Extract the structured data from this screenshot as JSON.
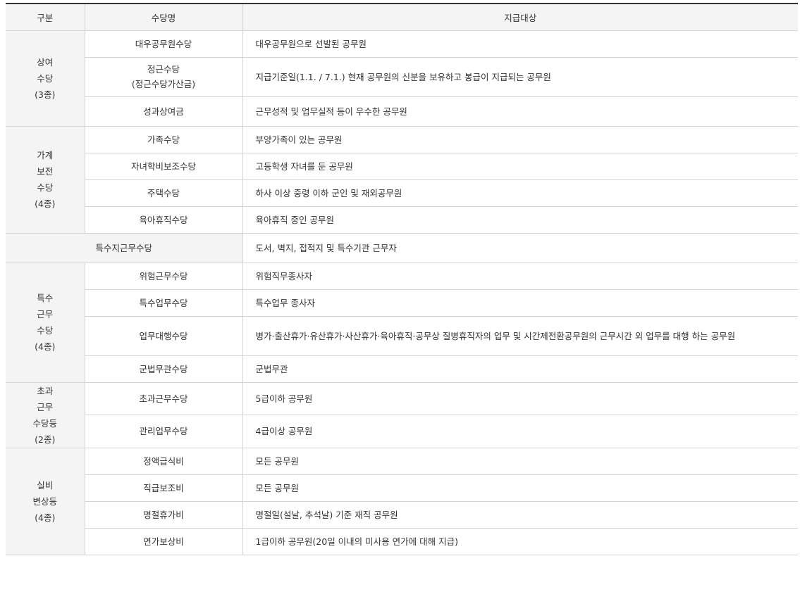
{
  "header": {
    "col1": "구분",
    "col2": "수당명",
    "col3": "지급대상"
  },
  "groups": [
    {
      "category": [
        "상여",
        "수당",
        "(3종)"
      ],
      "rows": [
        {
          "name": [
            "대우공무원수당"
          ],
          "target": "대우공무원으로 선발된 공무원"
        },
        {
          "name": [
            "정근수당",
            "(정근수당가산금)"
          ],
          "target": "지급기준일(1.1. / 7.1.) 현재 공무원의 신분을 보유하고 봉급이 지급되는 공무원"
        },
        {
          "name": [
            "성과상여금"
          ],
          "target": "근무성적 및 업무실적 등이 우수한 공무원"
        }
      ]
    },
    {
      "category": [
        "가계",
        "보전",
        "수당",
        "(4종)"
      ],
      "rows": [
        {
          "name": [
            "가족수당"
          ],
          "target": "부양가족이 있는 공무원"
        },
        {
          "name": [
            "자녀학비보조수당"
          ],
          "target": "고등학생 자녀를 둔 공무원"
        },
        {
          "name": [
            "주택수당"
          ],
          "target": "하사 이상 중령 이하 군인 및 재외공무원"
        },
        {
          "name": [
            "육아휴직수당"
          ],
          "target": "육아휴직 중인 공무원"
        }
      ]
    },
    {
      "wide_name": "특수지근무수당",
      "wide_target": "도서, 벽지, 접적지 및 특수기관 근무자"
    },
    {
      "category": [
        "특수",
        "근무",
        "수당",
        "(4종)"
      ],
      "rows": [
        {
          "name": [
            "위험근무수당"
          ],
          "target": "위험직무종사자"
        },
        {
          "name": [
            "특수업무수당"
          ],
          "target": "특수업무 종사자"
        },
        {
          "name": [
            "업무대행수당"
          ],
          "target": "병가·출산휴가·유산휴가·사산휴가·육아휴직·공무상 질병휴직자의 업무 및 시간제전환공무원의 근무시간 외 업무를 대행 하는 공무원"
        },
        {
          "name": [
            "군법무관수당"
          ],
          "target": "군법무관"
        }
      ]
    },
    {
      "category": [
        "초과",
        "근무",
        "수당등",
        "(2종)"
      ],
      "rows": [
        {
          "name": [
            "초과근무수당"
          ],
          "target": "5급이하 공무원"
        },
        {
          "name": [
            "관리업무수당"
          ],
          "target": "4급이상 공무원"
        }
      ]
    },
    {
      "category": [
        "실비",
        "변상등",
        "(4종)"
      ],
      "rows": [
        {
          "name": [
            "정액급식비"
          ],
          "target": "모든 공무원"
        },
        {
          "name": [
            "직급보조비"
          ],
          "target": "모든 공무원"
        },
        {
          "name": [
            "명절휴가비"
          ],
          "target": "명절일(설날, 추석날) 기준 재직 공무원"
        },
        {
          "name": [
            "연가보상비"
          ],
          "target": "1급이하 공무원(20일 이내의 미사용 연가에 대해 지급)"
        }
      ]
    }
  ]
}
